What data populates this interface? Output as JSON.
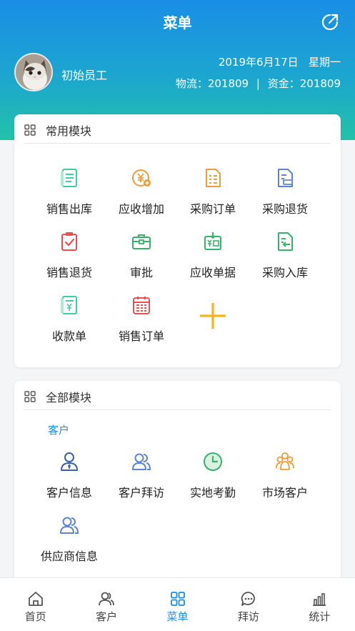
{
  "header": {
    "title": "菜单",
    "user_name": "初始员工",
    "date": "2019年6月17日",
    "weekday": "星期一",
    "logistics_label": "物流：",
    "logistics_value": "201809",
    "separator": "|",
    "funds_label": "资金：",
    "funds_value": "201809"
  },
  "common_modules": {
    "title": "常用模块",
    "items": [
      {
        "label": "销售出库",
        "icon": "document-list-icon",
        "color": "#3fcf9c"
      },
      {
        "label": "应收增加",
        "icon": "yen-coin-add-icon",
        "color": "#f29a3a"
      },
      {
        "label": "采购订单",
        "icon": "document-order-icon",
        "color": "#f29a3a"
      },
      {
        "label": "采购退货",
        "icon": "document-return-icon",
        "color": "#5b84d8"
      },
      {
        "label": "销售退货",
        "icon": "clipboard-check-icon",
        "color": "#e94f4f"
      },
      {
        "label": "审批",
        "icon": "briefcase-icon",
        "color": "#35b46a"
      },
      {
        "label": "应收单据",
        "icon": "yen-receipt-icon",
        "color": "#35b46a"
      },
      {
        "label": "采购入库",
        "icon": "document-in-icon",
        "color": "#35b46a"
      },
      {
        "label": "收款单",
        "icon": "receipt-yen-icon",
        "color": "#3fcf9c"
      },
      {
        "label": "销售订单",
        "icon": "calendar-order-icon",
        "color": "#e94f4f"
      }
    ],
    "add_icon": "plus-icon",
    "add_color": "#f5b320"
  },
  "all_modules": {
    "title": "全部模块",
    "category": "客户",
    "items": [
      {
        "label": "客户信息",
        "icon": "customer-tie-icon",
        "color": "#3b5fb0"
      },
      {
        "label": "客户拜访",
        "icon": "two-people-icon",
        "color": "#5b84d8"
      },
      {
        "label": "实地考勤",
        "icon": "clock-icon",
        "color": "#35b46a"
      },
      {
        "label": "市场客户",
        "icon": "group-icon",
        "color": "#f29a3a"
      },
      {
        "label": "供应商信息",
        "icon": "two-people-supplier-icon",
        "color": "#5b84d8"
      }
    ]
  },
  "tabbar": {
    "active_color": "#1a8ee6",
    "tabs": [
      {
        "label": "首页",
        "icon": "home-icon"
      },
      {
        "label": "客户",
        "icon": "customer-icon"
      },
      {
        "label": "菜单",
        "icon": "grid-icon",
        "active": true
      },
      {
        "label": "拜访",
        "icon": "chat-icon"
      },
      {
        "label": "统计",
        "icon": "bar-chart-icon"
      }
    ]
  }
}
